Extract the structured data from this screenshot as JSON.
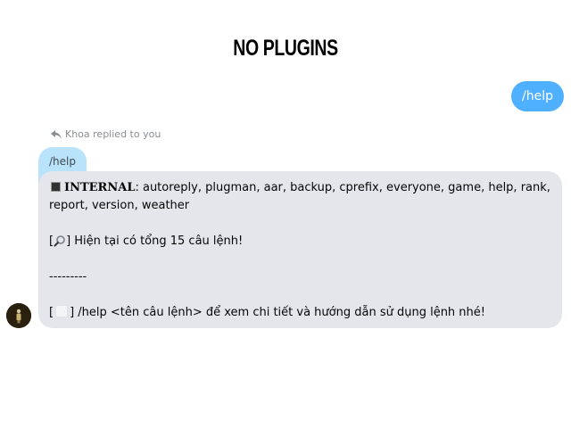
{
  "header": {
    "title": "NO PLUGINS"
  },
  "outgoing": {
    "text": "/help",
    "color": "#4fb0ff"
  },
  "reply_info": {
    "text": "Khoa replied to you"
  },
  "quoted": {
    "text": "/help"
  },
  "message": {
    "internal_label": "INTERNAL",
    "internal_rest": ": autoreply, plugman, aar, backup, cprefix, everyone, game, help, rank, report, version, weather",
    "count_open": "[",
    "count_text": "] Hiện tại có tổng 15 câu lệnh!",
    "separator": "---------",
    "hint_open": "[",
    "hint_text": "] /help <tên câu lệnh> để xem chi tiết và hướng dẫn sử dụng lệnh nhé!"
  },
  "colors": {
    "incoming_bubble": "#e4e6eb",
    "quoted_bubble": "#b9e2fb",
    "meta_text": "#8a8d91"
  },
  "icons": {
    "reply": "reply-arrow-icon",
    "count": "magnifier-icon",
    "hint": "blank-glyph-icon"
  }
}
